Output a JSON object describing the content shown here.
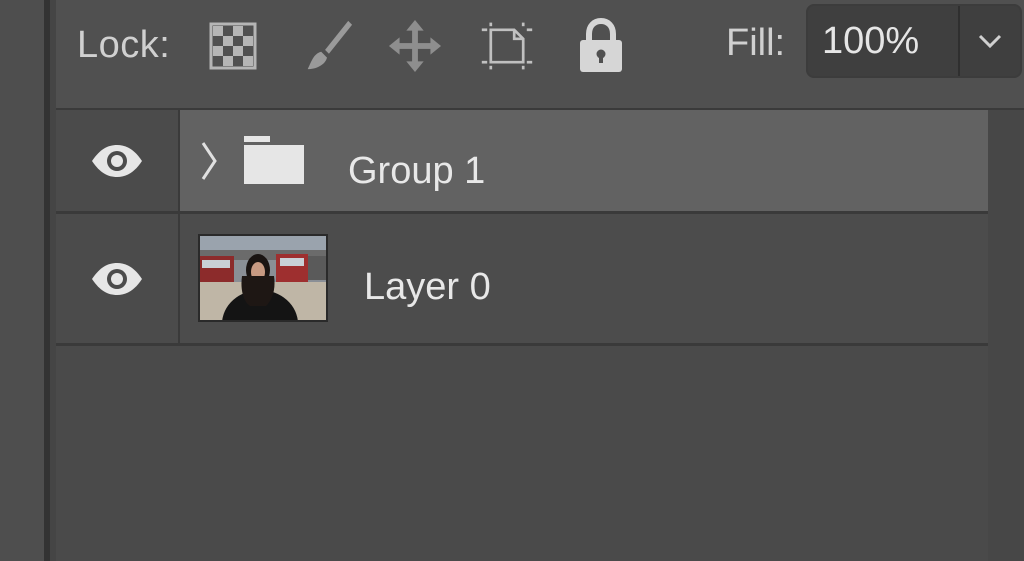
{
  "toolbar": {
    "lock_label": "Lock:",
    "fill_label": "Fill:",
    "fill_value": "100%",
    "icons": [
      "lock-transparent-pixels-icon",
      "lock-image-pixels-icon",
      "lock-position-icon",
      "lock-artboard-icon",
      "lock-all-icon"
    ]
  },
  "layers": [
    {
      "name": "Group 1",
      "type": "group",
      "visible": true,
      "selected": true
    },
    {
      "name": "Layer 0",
      "type": "pixel",
      "visible": true,
      "selected": false
    }
  ],
  "colors": {
    "panel_bg": "#4a4a4a",
    "selected_row": "#626262",
    "text": "#e8e8e8",
    "icon": "#c8c8c8"
  }
}
